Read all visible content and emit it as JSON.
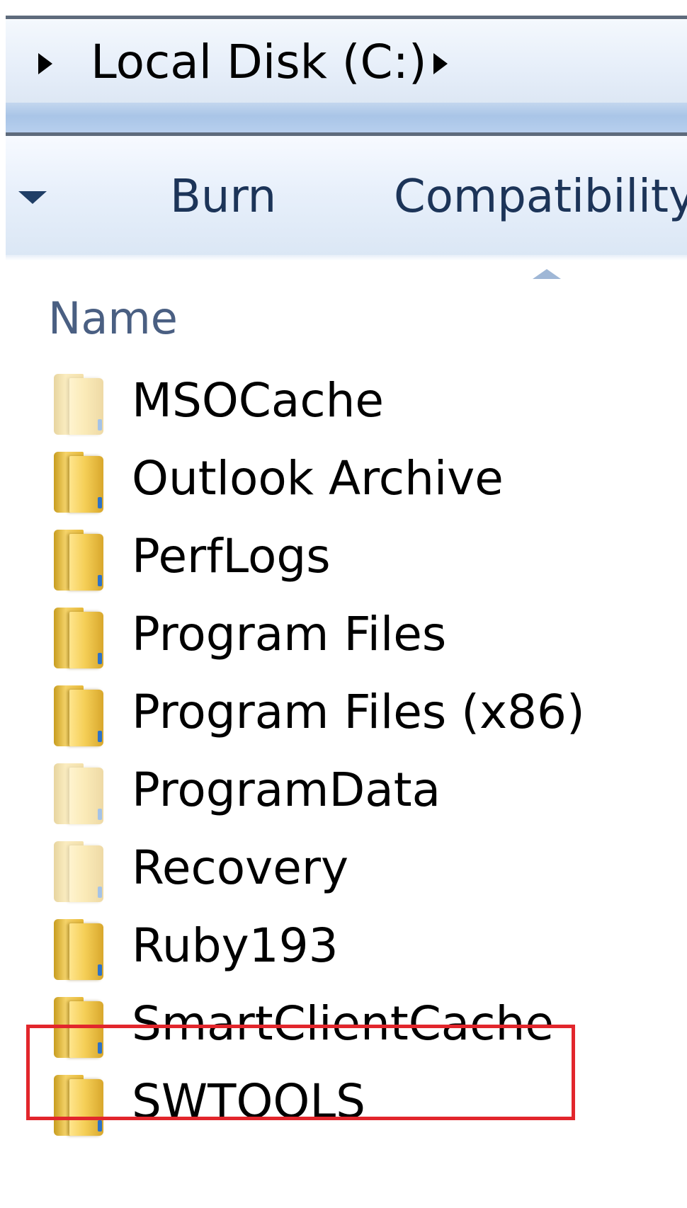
{
  "address_bar": {
    "crumbs": [
      "Local Disk (C:)"
    ]
  },
  "toolbar": {
    "burn_label": "Burn",
    "compatibility_label": "Compatibility"
  },
  "columns": {
    "name_label": "Name",
    "sort_direction": "ascending"
  },
  "files": [
    {
      "name": "MSOCache",
      "icon": "folder-icon",
      "hidden": true
    },
    {
      "name": "Outlook Archive",
      "icon": "folder-icon",
      "hidden": false
    },
    {
      "name": "PerfLogs",
      "icon": "folder-icon",
      "hidden": false
    },
    {
      "name": "Program Files",
      "icon": "folder-icon",
      "hidden": false
    },
    {
      "name": "Program Files (x86)",
      "icon": "folder-icon",
      "hidden": false
    },
    {
      "name": "ProgramData",
      "icon": "folder-icon",
      "hidden": true
    },
    {
      "name": "Recovery",
      "icon": "folder-icon",
      "hidden": true
    },
    {
      "name": "Ruby193",
      "icon": "folder-icon",
      "hidden": false
    },
    {
      "name": "SmartClientCache",
      "icon": "folder-icon",
      "hidden": false,
      "highlighted": true
    },
    {
      "name": "SWTOOLS",
      "icon": "folder-icon",
      "hidden": false
    }
  ],
  "colors": {
    "highlight": "#e2262c",
    "toolbar_text": "#1c3458",
    "header_text": "#4a5f82"
  }
}
